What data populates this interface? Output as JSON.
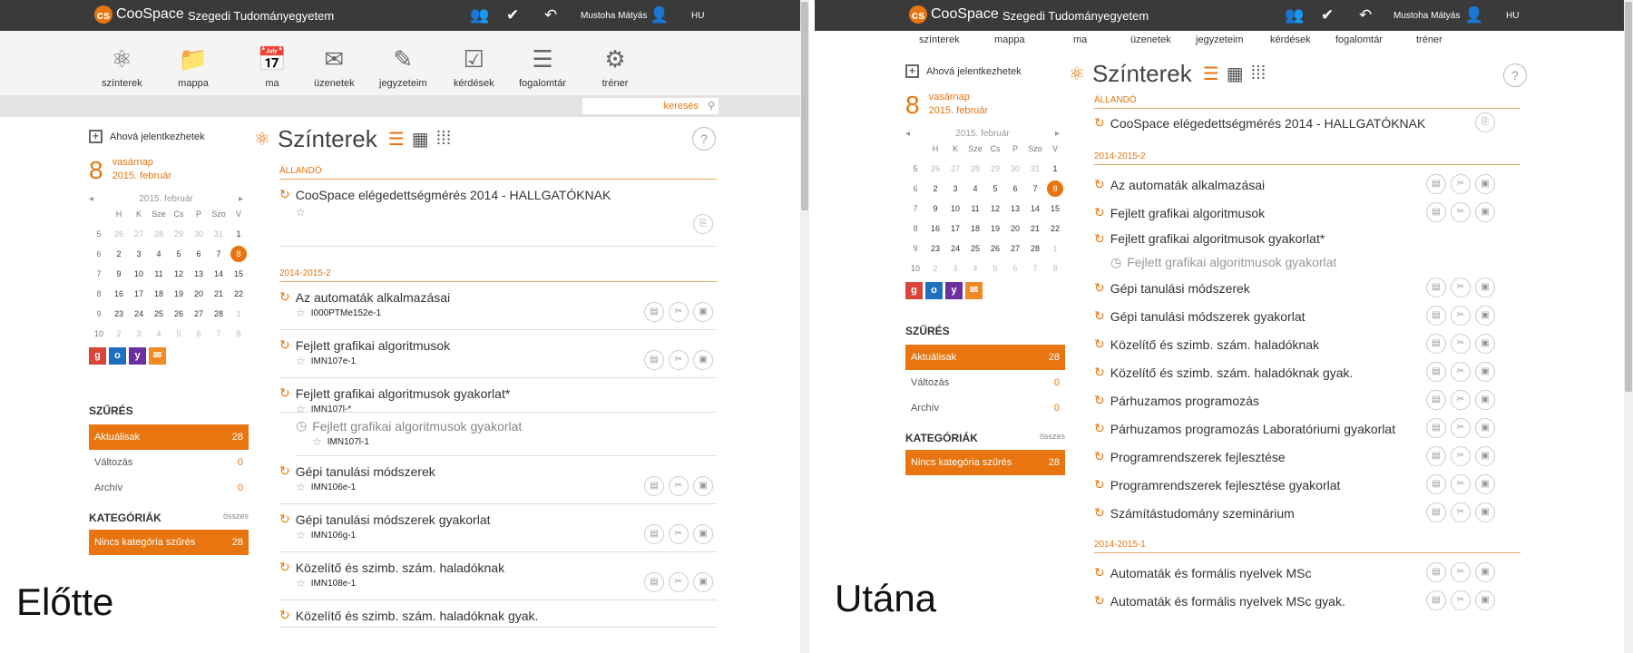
{
  "colors": {
    "accent": "#e8750f",
    "topbar": "#3a3a3a",
    "google": "#d9453a",
    "outlook": "#1e6fbf",
    "yahoo": "#6b2fa0",
    "mail": "#f08a24"
  },
  "app": {
    "name": "CooSpace",
    "university": "Szegedi Tudományegyetem",
    "user": "Mustoha Mátyás",
    "lang": "HU"
  },
  "topbar_icons": [
    "people-icon",
    "check-circle-icon",
    "undo-icon",
    "user-icon"
  ],
  "nav": [
    {
      "label": "színterek",
      "icon": "scenes-icon"
    },
    {
      "label": "mappa",
      "icon": "folder-icon"
    },
    {
      "label": "ma",
      "icon": "calendar-icon"
    },
    {
      "label": "üzenetek",
      "icon": "envelope-icon"
    },
    {
      "label": "jegyzeteim",
      "icon": "pen-icon"
    },
    {
      "label": "kérdések",
      "icon": "question-check-icon"
    },
    {
      "label": "fogalomtár",
      "icon": "glossary-icon"
    },
    {
      "label": "tréner",
      "icon": "trainer-icon"
    }
  ],
  "search_placeholder": "keresés",
  "sidebar": {
    "add_label": "Ahová jelentkezhetek",
    "day": "8",
    "weekday": "vasárnap",
    "date": "2015. február",
    "calendar": {
      "month": "2015. február",
      "headers": [
        "H",
        "K",
        "Sze",
        "Cs",
        "P",
        "Szo",
        "V"
      ],
      "weeks": [
        {
          "wk": "5",
          "days": [
            "26",
            "27",
            "28",
            "29",
            "30",
            "31",
            "1"
          ]
        },
        {
          "wk": "6",
          "days": [
            "2",
            "3",
            "4",
            "5",
            "6",
            "7",
            "8"
          ]
        },
        {
          "wk": "7",
          "days": [
            "9",
            "10",
            "11",
            "12",
            "13",
            "14",
            "15"
          ]
        },
        {
          "wk": "8",
          "days": [
            "16",
            "17",
            "18",
            "19",
            "20",
            "21",
            "22"
          ]
        },
        {
          "wk": "9",
          "days": [
            "23",
            "24",
            "25",
            "26",
            "27",
            "28",
            "1"
          ]
        },
        {
          "wk": "10",
          "days": [
            "2",
            "3",
            "4",
            "5",
            "6",
            "7",
            "8"
          ]
        }
      ]
    },
    "filter_title": "SZŰRÉS",
    "filters": [
      {
        "label": "Aktuálisak",
        "count": "28"
      },
      {
        "label": "Változás",
        "count": "0"
      },
      {
        "label": "Archív",
        "count": "0"
      }
    ],
    "cat_title": "KATEGÓRIÁK",
    "cat_all": "összes",
    "cat_item": {
      "label": "Nincs kategória szűrés",
      "count": "28"
    }
  },
  "main": {
    "title": "Színterek",
    "help": "?",
    "sec_permanent": "ÁLLANDÓ",
    "permanent_course": "CooSpace elégedettségmérés 2014 - HALLGATÓKNAK",
    "sec_term": "2014-2015-2",
    "sec_term2": "2014-2015-1"
  },
  "left_courses": [
    {
      "name": "Az automaták alkalmazásai",
      "code": "I000PTMe152e-1"
    },
    {
      "name": "Fejlett grafikai algoritmusok",
      "code": "IMN107e-1"
    },
    {
      "name": "Fejlett grafikai algoritmusok gyakorlat*",
      "code": "IMN107l-*"
    },
    {
      "name": "Fejlett grafikai algoritmusok gyakorlat",
      "code": "IMN107l-1"
    },
    {
      "name": "Gépi tanulási módszerek",
      "code": "IMN106e-1"
    },
    {
      "name": "Gépi tanulási módszerek gyakorlat",
      "code": "IMN106g-1"
    },
    {
      "name": "Közelítő és szimb. szám. haladóknak",
      "code": "IMN108e-1"
    },
    {
      "name": "Közelítő és szimb. szám. haladóknak gyak."
    }
  ],
  "right_courses": [
    "Az automaták alkalmazásai",
    "Fejlett grafikai algoritmusok",
    "Fejlett grafikai algoritmusok gyakorlat*",
    "Fejlett grafikai algoritmusok gyakorlat",
    "Gépi tanulási módszerek",
    "Gépi tanulási módszerek gyakorlat",
    "Közelítő és szimb. szám. haladóknak",
    "Közelítő és szimb. szám. haladóknak gyak.",
    "Párhuzamos programozás",
    "Párhuzamos programozás Laboratóriumi gyakorlat",
    "Programrendszerek fejlesztése",
    "Programrendszerek fejlesztése gyakorlat",
    "Számítástudomány szeminárium"
  ],
  "right_courses_term2": [
    "Automaták és formális nyelvek MSc",
    "Automaták és formális nyelvek MSc gyak."
  ],
  "captions": {
    "before": "Előtte",
    "after": "Utána"
  }
}
